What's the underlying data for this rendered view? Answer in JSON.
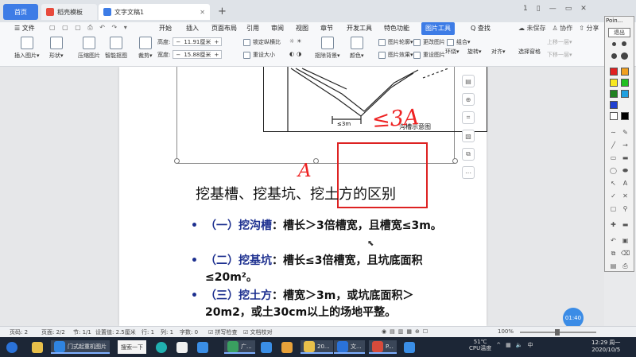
{
  "tabs": {
    "home": "首页",
    "template": "稻壳模板",
    "document": "文字文稿1",
    "new_tab": "+"
  },
  "titlebar_right": [
    "1",
    "▯",
    "—",
    "▭",
    "✕"
  ],
  "menu": {
    "file": "☰ 文件",
    "quick": "▢ ▢ ▢ ⎙ ↶ ↷ ▾",
    "items": [
      "开始",
      "插入",
      "页面布局",
      "引用",
      "审阅",
      "视图",
      "章节",
      "开发工具",
      "特色功能"
    ],
    "picture_tools": "图片工具",
    "search": "Q 查找",
    "right": [
      "☁ 未保存",
      "♙ 协作",
      "⇧ 分享"
    ]
  },
  "ribbon": {
    "insert_picture": "插入图片▾",
    "shape": "形状▾",
    "compress": "压缩图片",
    "smart_cut": "智能抠图",
    "crop": "裁剪▾",
    "height_label": "高度:",
    "height_value": "11.91厘米",
    "width_label": "宽度:",
    "width_value": "15.88厘米",
    "lock_ratio": "锁定纵横比",
    "reset_size": "重设大小",
    "clear_bg": "抠除背景▾",
    "color": "颜色▾",
    "outline": "图片轮廓▾",
    "effect": "图片效果▾",
    "change_pic": "更改图片",
    "reset_pic": "重设图片",
    "combine": "组合▾",
    "rotate": "旋转▾",
    "wrap": "环绕▾",
    "align": "对齐▾",
    "select_pane": "选择窗格",
    "up_layer": "上移一层▾",
    "down_layer": "下移一层▾"
  },
  "document": {
    "figure_dim": "≤3m",
    "figure_caption": "沟槽示意图",
    "annotation_lt3a": "≤3A",
    "annotation_a": "A",
    "title": "挖基槽、挖基坑、挖土方的区别",
    "bullets": [
      {
        "prefix": "（一）",
        "keyword": "挖沟槽",
        "text": "：槽长＞3倍槽宽，且槽宽≤3m。"
      },
      {
        "prefix": "（二）",
        "keyword": "挖基坑",
        "text": "：槽长≤3倍槽宽，且坑底面积≤20m²。"
      },
      {
        "prefix": "（三）",
        "keyword": "挖土方",
        "text": "：槽宽＞3m，或坑底面积＞20m2，或土30cm以上的场地平整。"
      }
    ],
    "time_bubble": "01:40"
  },
  "palette": {
    "title": "Poin...",
    "exit": "退出",
    "colors": [
      "#e02020",
      "#f0a020",
      "#f8e820",
      "#20c020",
      "#208020",
      "#20a0e0",
      "#2040d0",
      "#ffffff",
      "#000000"
    ]
  },
  "statusbar": {
    "page": "页码: 2",
    "pages": "页面: 2/2",
    "section": "节: 1/1",
    "setting": "设置值: 2.5厘米",
    "row": "行: 1",
    "col": "列: 1",
    "words": "字数: 0",
    "spell": "☑ 拼写检查",
    "proof": "☑ 文档校对",
    "zoom": "100%"
  },
  "taskbar": {
    "ie_label": "门式起重机图片",
    "search_label": "搜索一下",
    "item_guang": "广...",
    "item_20": "20...",
    "item_wen": "文...",
    "item_p": "P...",
    "weather": "51℃",
    "cpu": "CPU温度",
    "time": "12:29 周一",
    "date": "2020/10/5"
  }
}
